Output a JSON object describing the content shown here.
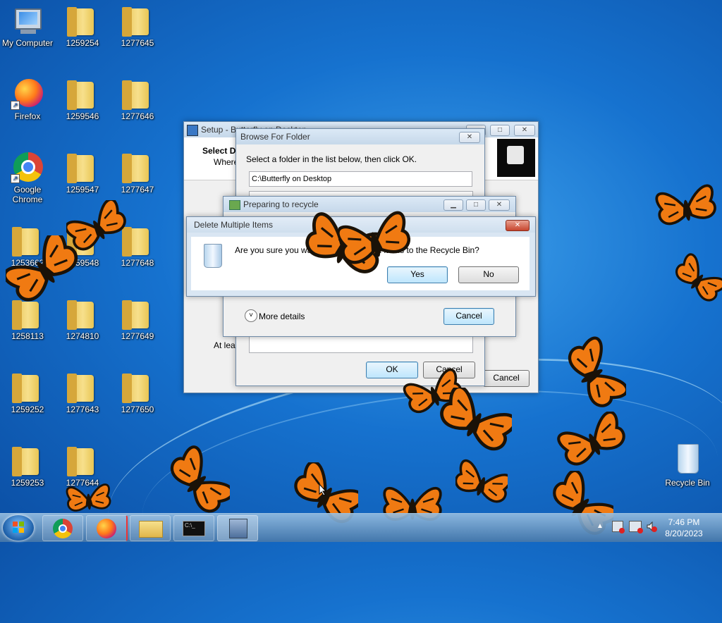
{
  "desktop_icons": [
    {
      "id": "mycomputer",
      "label": "My Computer",
      "type": "computer"
    },
    {
      "id": "f1259254",
      "label": "1259254",
      "type": "folder"
    },
    {
      "id": "f1277645",
      "label": "1277645",
      "type": "folder"
    },
    {
      "id": "firefox",
      "label": "Firefox",
      "type": "firefox"
    },
    {
      "id": "f1259546",
      "label": "1259546",
      "type": "folder"
    },
    {
      "id": "f1277646",
      "label": "1277646",
      "type": "folder"
    },
    {
      "id": "chrome",
      "label": "Google Chrome",
      "type": "chrome"
    },
    {
      "id": "f1259547",
      "label": "1259547",
      "type": "folder"
    },
    {
      "id": "f1277647",
      "label": "1277647",
      "type": "folder"
    },
    {
      "id": "f1253662",
      "label": "1253662",
      "type": "folder"
    },
    {
      "id": "f1259548",
      "label": "1259548",
      "type": "folder"
    },
    {
      "id": "f1277648",
      "label": "1277648",
      "type": "folder"
    },
    {
      "id": "f1258113",
      "label": "1258113",
      "type": "folder"
    },
    {
      "id": "f1274810",
      "label": "1274810",
      "type": "folder"
    },
    {
      "id": "f1277649",
      "label": "1277649",
      "type": "folder"
    },
    {
      "id": "f1259252",
      "label": "1259252",
      "type": "folder"
    },
    {
      "id": "f1277643",
      "label": "1277643",
      "type": "folder"
    },
    {
      "id": "f1277650",
      "label": "1277650",
      "type": "folder"
    },
    {
      "id": "f1259253",
      "label": "1259253",
      "type": "folder"
    },
    {
      "id": "f1277644",
      "label": "1277644",
      "type": "folder"
    },
    {
      "id": "recyclebin",
      "label": "Recycle Bin",
      "type": "recycle"
    }
  ],
  "setup_window": {
    "title": "Setup - Butterfly on Desktop",
    "heading": "Select D",
    "subtext": "Where",
    "footer_text": "At leas",
    "cancel_label": "Cancel"
  },
  "browse_dialog": {
    "title": "Browse For Folder",
    "instruction": "Select a folder in the list below, then click OK.",
    "path_value": "C:\\Butterfly on Desktop",
    "ok_label": "OK",
    "cancel_label": "Cancel",
    "close_label": "✕"
  },
  "preparing_dialog": {
    "title": "Preparing to recycle",
    "more_details_label": "More details",
    "cancel_label": "Cancel"
  },
  "delete_dialog": {
    "title": "Delete Multiple Items",
    "message": "Are you sure you want to move these 2 items to the Recycle Bin?",
    "yes_label": "Yes",
    "no_label": "No",
    "close_label": "✕"
  },
  "taskbar": {
    "time": "7:46 PM",
    "date": "8/20/2023",
    "buttons": [
      "chrome",
      "firefox",
      "explorer",
      "cmd",
      "setup"
    ]
  },
  "colors": {
    "butterfly_orange": "#f07a12",
    "butterfly_black": "#1a1208",
    "desktop_blue": "#1672cf"
  }
}
